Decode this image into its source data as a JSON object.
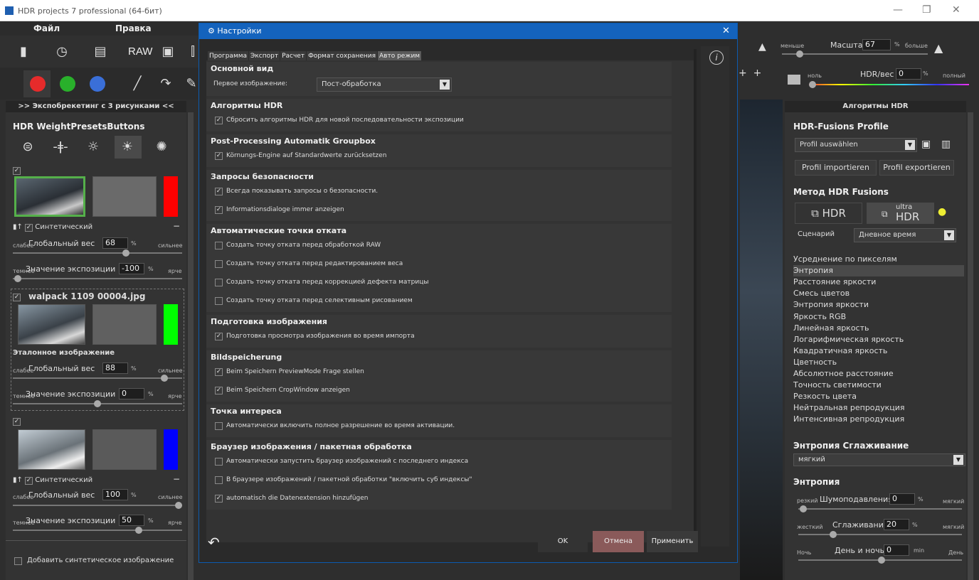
{
  "window": {
    "title": "HDR projects 7 professional (64-бит)"
  },
  "menu": [
    "Файл",
    "Правка"
  ],
  "toolbar": {
    "raw_label": "RAW"
  },
  "left": {
    "header": ">> Экспобрекетинг с 3 рисунками <<",
    "presets_title": "HDR WeightPresetsButtons",
    "images": [
      {
        "synthetic_label": "Синтетический",
        "weak": "слабее",
        "weight_label": "Глобальный вес",
        "weight": "68",
        "pct": "%",
        "strong": "сильнее",
        "dark": "темнее",
        "exposure_label": "Значение экспозиции",
        "exposure": "-100",
        "bright": "ярче",
        "color": "#ff0000"
      },
      {
        "filename": "walpack 1109 00004.jpg",
        "ref_label": "Эталонное изображение",
        "weak": "слабее",
        "weight_label": "Глобальный вес",
        "weight": "88",
        "pct": "%",
        "strong": "сильнее",
        "dark": "темнее",
        "exposure_label": "Значение экспозиции",
        "exposure": "0",
        "bright": "ярче",
        "color": "#00ff00"
      },
      {
        "synthetic_label": "Синтетический",
        "weak": "слабее",
        "weight_label": "Глобальный вес",
        "weight": "100",
        "pct": "%",
        "strong": "сильнее",
        "dark": "темнее",
        "exposure_label": "Значение экспозиции",
        "exposure": "50",
        "bright": "ярче",
        "color": "#0000ff"
      }
    ],
    "add_synthetic": "Добавить синтетическое изображение"
  },
  "topright": {
    "less": "меньше",
    "scale_label": "Масштаб",
    "scale": "67",
    "pct": "%",
    "more": "больше",
    "zero": "ноль",
    "weight_label": "HDR/вес",
    "weight": "0",
    "full": "полный"
  },
  "dialog": {
    "title": "Настройки",
    "tabs": [
      "Программа",
      "Экспорт",
      "Расчет",
      "Формат сохранения",
      "Авто режим"
    ],
    "active_tab": 4,
    "sections": [
      {
        "title": "Основной вид",
        "first_image_label": "Первое изображение:",
        "first_image_value": "Пост-обработка"
      },
      {
        "title": "Алгоритмы HDR",
        "items": [
          {
            "label": "Сбросить алгоритмы HDR для новой последовательности экспозиции",
            "checked": true
          }
        ]
      },
      {
        "title": "Post-Processing Automatik Groupbox",
        "items": [
          {
            "label": "Körnungs-Engine auf Standardwerte zurücksetzen",
            "checked": true
          }
        ]
      },
      {
        "title": "Запросы безопасности",
        "items": [
          {
            "label": "Всегда показывать запросы о безопасности.",
            "checked": true
          },
          {
            "label": "Informationsdialoge immer anzeigen",
            "checked": true
          }
        ]
      },
      {
        "title": "Автоматические точки отката",
        "items": [
          {
            "label": "Создать точку отката перед обработкой RAW",
            "checked": false
          },
          {
            "label": "Создать точку отката перед редактированием веса",
            "checked": false
          },
          {
            "label": "Создать точку отката перед коррекцией дефекта матрицы",
            "checked": false
          },
          {
            "label": "Создать точку отката перед селективным рисованием",
            "checked": false
          }
        ]
      },
      {
        "title": "Подготовка изображения",
        "items": [
          {
            "label": "Подготовка просмотра изображения во время импорта",
            "checked": true
          }
        ]
      },
      {
        "title": "Bildspeicherung",
        "items": [
          {
            "label": "Beim Speichern PreviewMode Frage stellen",
            "checked": true
          },
          {
            "label": "Beim Speichern CropWindow anzeigen",
            "checked": true
          }
        ]
      },
      {
        "title": "Точка интереса",
        "items": [
          {
            "label": "Автоматически включить полное разрешение во время активации.",
            "checked": false
          }
        ]
      },
      {
        "title": "Браузер изображения / пакетная обработка",
        "items": [
          {
            "label": "Автоматически запустить браузер изображений с последнего индекса",
            "checked": false
          },
          {
            "label": "В браузере изображений / пакетной обработки \"включить суб индексы\"",
            "checked": false
          },
          {
            "label": "automatisch die Datenextension hinzufügen",
            "checked": true
          }
        ]
      }
    ],
    "ok": "OK",
    "cancel": "Отмена",
    "apply": "Применить"
  },
  "right": {
    "header": "Алгоритмы HDR",
    "profile_title": "HDR-Fusions Profile",
    "profile_select": "Profil auswählen",
    "import": "Profil importieren",
    "export": "Profil exportieren",
    "method_title": "Метод HDR Fusions",
    "hdr": "HDR",
    "ultra": "ultra",
    "ultra_hdr": "HDR",
    "scenario_label": "Сценарий",
    "scenario_value": "Дневное время",
    "algorithms": [
      "Усреднение по пикселям",
      "Энтропия",
      "Расстояние яркости",
      "Смесь цветов",
      "Энтропия яркости",
      "Яркость RGB",
      "Линейная яркость",
      "Логарифмическая яркость",
      "Квадратичная яркость",
      "Цветность",
      "Абсолютное расстояние",
      "Точность светимости",
      "Резкость цвета",
      "Нейтральная репродукция",
      "Интенсивная репродукция"
    ],
    "selected_algorithm": 1,
    "smoothing_title": "Энтропия Сглаживание",
    "smoothing_value": "мягкий",
    "entropy_title": "Энтропия",
    "noise": {
      "left": "резкий",
      "label": "Шумоподавления",
      "value": "0",
      "pct": "%",
      "right": "мягкий"
    },
    "smooth": {
      "left": "жесткий",
      "label": "Сглаживание",
      "value": "20",
      "pct": "%",
      "right": "мягкий"
    },
    "daynight": {
      "left": "Ночь",
      "label": "День и ночь",
      "value": "0",
      "unit": "min",
      "right": "День"
    }
  }
}
